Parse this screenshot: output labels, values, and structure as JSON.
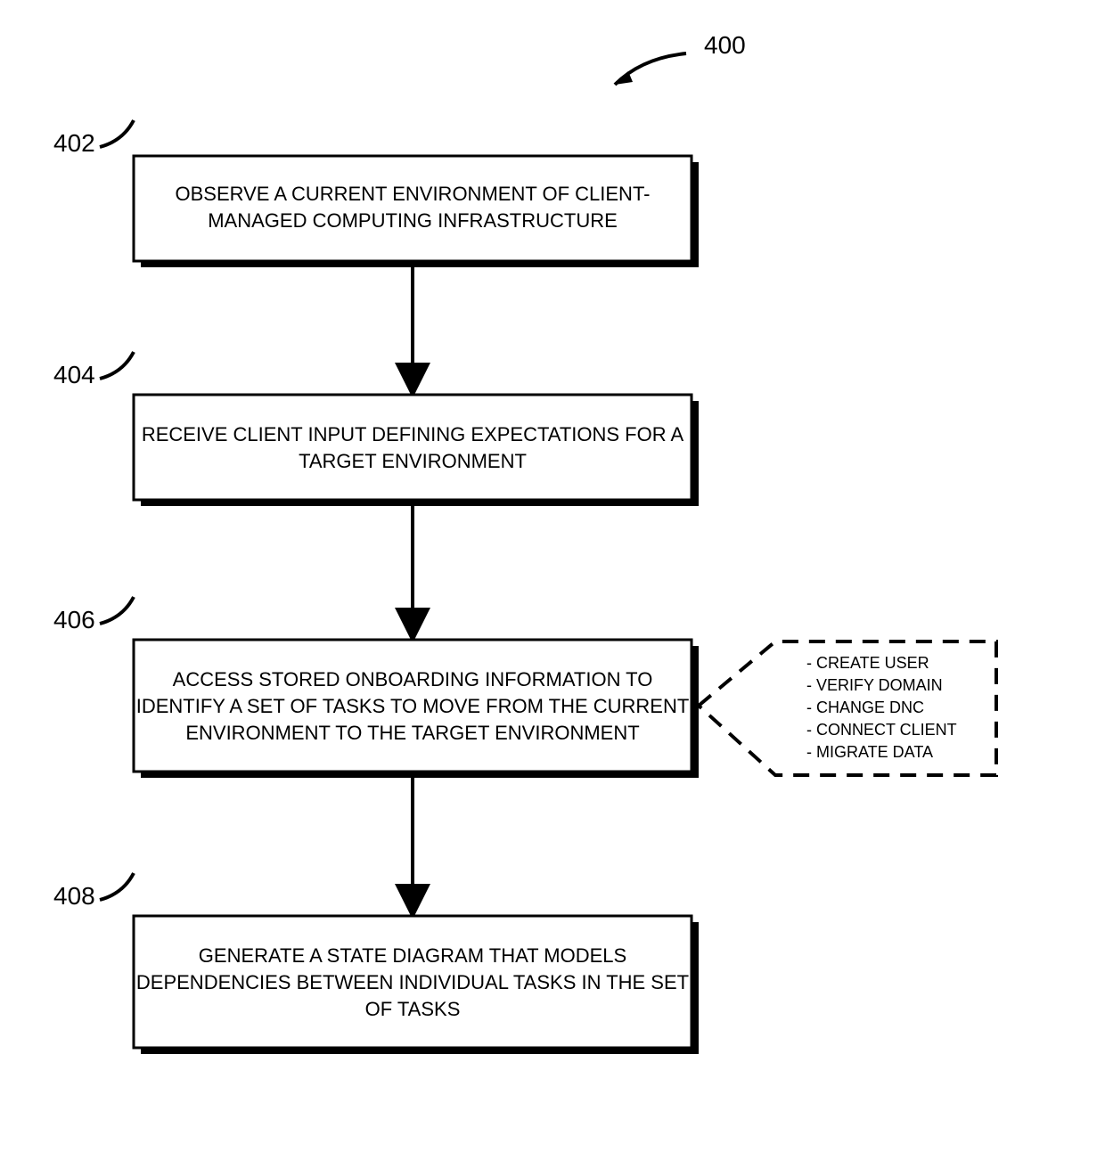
{
  "figure": {
    "number": "400",
    "steps": [
      {
        "id": "402",
        "lines": [
          "OBSERVE A CURRENT ENVIRONMENT OF CLIENT-",
          "MANAGED COMPUTING INFRASTRUCTURE"
        ]
      },
      {
        "id": "404",
        "lines": [
          "RECEIVE CLIENT INPUT DEFINING EXPECTATIONS FOR A",
          "TARGET ENVIRONMENT"
        ]
      },
      {
        "id": "406",
        "lines": [
          "ACCESS STORED ONBOARDING INFORMATION TO",
          "IDENTIFY A SET OF TASKS TO MOVE FROM THE CURRENT",
          "ENVIRONMENT TO THE TARGET ENVIRONMENT"
        ]
      },
      {
        "id": "408",
        "lines": [
          "GENERATE A STATE DIAGRAM THAT MODELS",
          "DEPENDENCIES BETWEEN INDIVIDUAL TASKS IN THE SET",
          "OF TASKS"
        ]
      }
    ],
    "callout": {
      "items": [
        "- CREATE USER",
        "- VERIFY DOMAIN",
        "- CHANGE DNC",
        "- CONNECT CLIENT",
        "- MIGRATE DATA"
      ]
    }
  }
}
